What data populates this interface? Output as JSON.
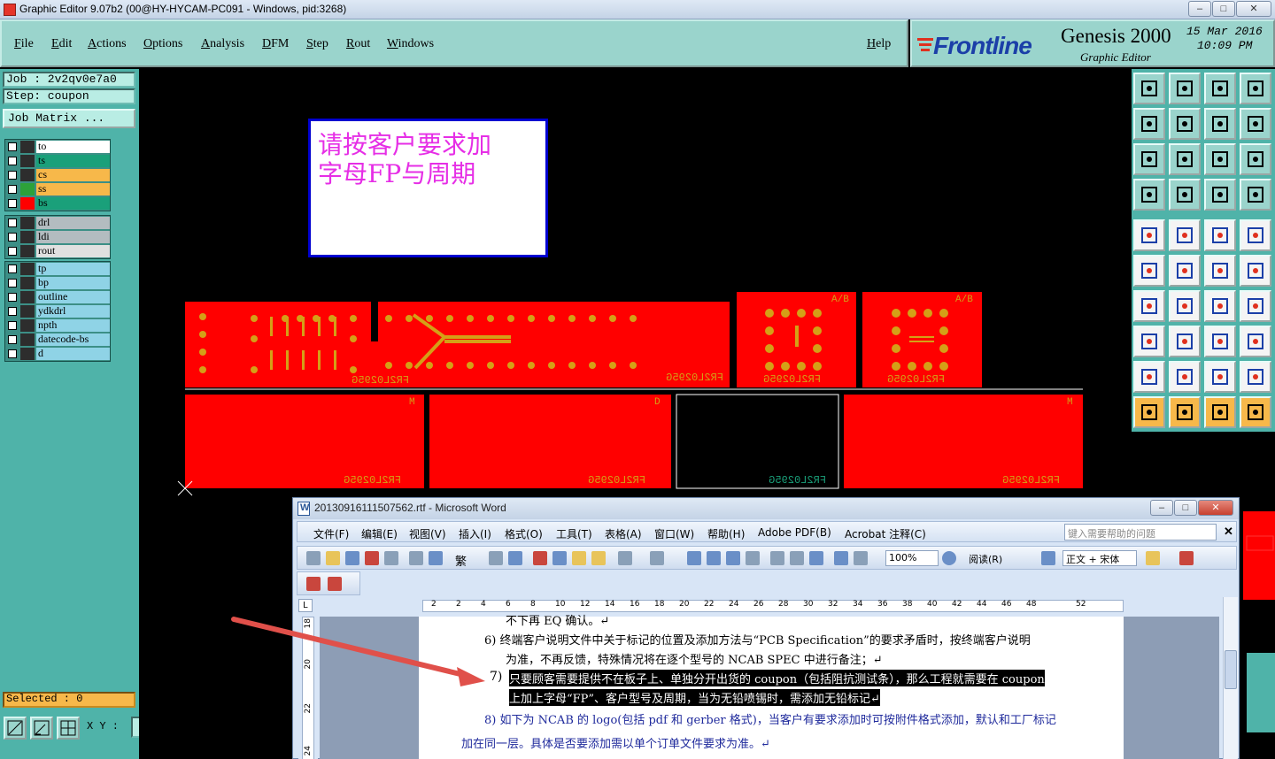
{
  "window": {
    "title": "Graphic Editor 9.07b2 (00@HY-HYCAM-PC091 - Windows, pid:3268)",
    "buttons": [
      "–",
      "□",
      "✕"
    ]
  },
  "menubar": {
    "items": [
      "File",
      "Edit",
      "Actions",
      "Options",
      "Analysis",
      "DFM",
      "Step",
      "Rout",
      "Windows"
    ],
    "help": "Help"
  },
  "brand": {
    "logo": "Frontline",
    "product": "Genesis 2000",
    "subtitle": "Graphic Editor",
    "date": "15 Mar 2016",
    "time": "10:09 PM"
  },
  "left": {
    "job": "Job : 2v2qv0e7a0",
    "step": "Step: coupon",
    "job_matrix": "Job Matrix ...",
    "selected": "Selected : 0",
    "layer_groups": [
      [
        {
          "name": "to",
          "color": "#ffffff"
        },
        {
          "name": "ts",
          "color": "#1aa07a"
        },
        {
          "name": "cs",
          "color": "#f7b84a"
        },
        {
          "name": "ss",
          "color": "#f7b84a"
        },
        {
          "name": "bs",
          "color": "#1aa07a"
        }
      ],
      [
        {
          "name": "drl",
          "color": "#b3bcc0"
        },
        {
          "name": "ldi",
          "color": "#b3bcc0"
        },
        {
          "name": "rout",
          "color": "#e0e0e0"
        }
      ],
      [
        {
          "name": "tp",
          "color": "#8fd3e6"
        },
        {
          "name": "bp",
          "color": "#8fd3e6"
        },
        {
          "name": "outline",
          "color": "#8fd3e6"
        },
        {
          "name": "ydkdrl",
          "color": "#8fd3e6"
        },
        {
          "name": "npth",
          "color": "#8fd3e6"
        },
        {
          "name": "datecode-bs",
          "color": "#8fd3e6"
        },
        {
          "name": "d",
          "color": "#8fd3e6"
        }
      ]
    ],
    "xy_label": "X Y :",
    "xy_value": ""
  },
  "canvas": {
    "note_lines": [
      "请按客户要求加",
      "字母FP与周期"
    ],
    "board_label": "FR2L0295G",
    "board_label_outline": "FR2L0295G",
    "corner_marks": [
      "A/B",
      "A/B",
      "M",
      "D",
      "M"
    ],
    "colors": {
      "copper": "#ff0000",
      "pad": "#d4a017",
      "bg": "#000000"
    }
  },
  "word": {
    "title": "20130916111507562.rtf - Microsoft Word",
    "menu": [
      "文件(F)",
      "编辑(E)",
      "视图(V)",
      "插入(I)",
      "格式(O)",
      "工具(T)",
      "表格(A)",
      "窗口(W)",
      "帮助(H)",
      "Adobe PDF(B)",
      "Acrobat 注释(C)"
    ],
    "help_placeholder": "键入需要帮助的问题",
    "zoom": "100%",
    "read_mode": "阅读(R)",
    "style": "正文 + 宋体",
    "trad": "繁",
    "ruler_ticks": [
      "2",
      "2",
      "4",
      "6",
      "8",
      "10",
      "12",
      "14",
      "16",
      "18",
      "20",
      "22",
      "24",
      "26",
      "28",
      "30",
      "32",
      "34",
      "36",
      "38",
      "40",
      "42",
      "44",
      "46",
      "48",
      "52"
    ],
    "ruler_l": "L",
    "vruler_ticks": [
      "18",
      "20",
      "22",
      "24"
    ],
    "paragraphs": {
      "p0": "不下再 EQ 确认。↵",
      "p6a": "6)   终端客户说明文件中关于标记的位置及添加方法与“PCB Specification”的要求矛盾时，按终端客户说明",
      "p6b": "为准，不再反馈，特殊情况将在逐个型号的 NCAB SPEC 中进行备注；↵",
      "p7num": "7)",
      "p7a": "只要顾客需要提供不在板子上、单独分开出货的 coupon（包括阻抗测试条），那么工程就需要在 coupon",
      "p7b": "上加上字母“FP”、客户型号及周期，当为无铅喷锡时，需添加无铅标记↵",
      "p8a": "8)   如下为 NCAB 的 logo(包括 pdf 和 gerber 格式)，当客户有要求添加时可按附件格式添加，默认和工厂标记",
      "p8b": "加在同一层。具体是否要添加需以单个订单文件要求为准。↵"
    }
  }
}
